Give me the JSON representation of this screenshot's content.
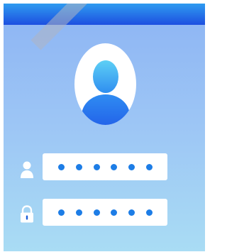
{
  "login": {
    "username_field": {
      "masked_length": 6
    },
    "password_field": {
      "masked_length": 6
    }
  },
  "icons": {
    "avatar": "user-avatar-icon",
    "username": "user-icon",
    "password": "lock-icon"
  },
  "colors": {
    "header_top": "#2f9bf0",
    "header_bottom": "#1d4fe0",
    "background_top": "#8db4f4",
    "background_bottom": "#a9dcf4",
    "accent": "#1d7de6"
  }
}
